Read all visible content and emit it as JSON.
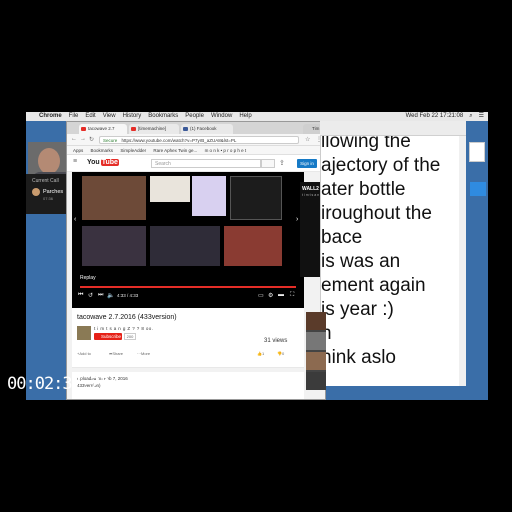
{
  "menubar": {
    "items": [
      "Chrome",
      "File",
      "Edit",
      "View",
      "History",
      "Bookmarks",
      "People",
      "Window",
      "Help"
    ],
    "clock": "Wed Feb 22  17:21:08",
    "user": "Tim"
  },
  "call": {
    "header": "Current Call",
    "name": "Parches",
    "time": "07:36"
  },
  "browser": {
    "tabs": [
      "tacowave 2.7",
      "[timemachine]",
      "(1) Facebook",
      "Tim"
    ],
    "url": "https://www.youtube.com/watch?v=P7yrB_aZUA8&lst=PL",
    "secure_label": "Secure",
    "bookmarks": [
      "Apps",
      "Bookmarks",
      "SimpleAdder",
      "Rare Aphex Twin ge...",
      "m o n k • p r o p h e t"
    ]
  },
  "youtube": {
    "search_placeholder": "Search",
    "sign_in": "Sign in",
    "replay": "Replay",
    "time": "4:33 / 4:33",
    "progress": 1.0,
    "video_title": "tacowave 2.7.2016 (433version)",
    "channel": "t i m t s a n g Z ? ? 8 oo.",
    "subscribe": "Subscribe",
    "sub_count": "200",
    "views": "31 views",
    "add_to": "Add to",
    "share": "Share",
    "more": "More",
    "likes": "1",
    "dislikes": "0",
    "published": "Uploaded on Feb 7, 2016",
    "description": "433version)"
  },
  "wall": {
    "title": "WALL2",
    "subtitle": "t i m t s a n g"
  },
  "notes": {
    "lines": [
      "llowing the",
      "ajectory of the",
      "ater bottle",
      "iroughout the",
      "bace",
      "is was an",
      "ement again",
      "is year :)",
      "n",
      "hink aslo"
    ]
  },
  "timecode": "00:02:37;23"
}
